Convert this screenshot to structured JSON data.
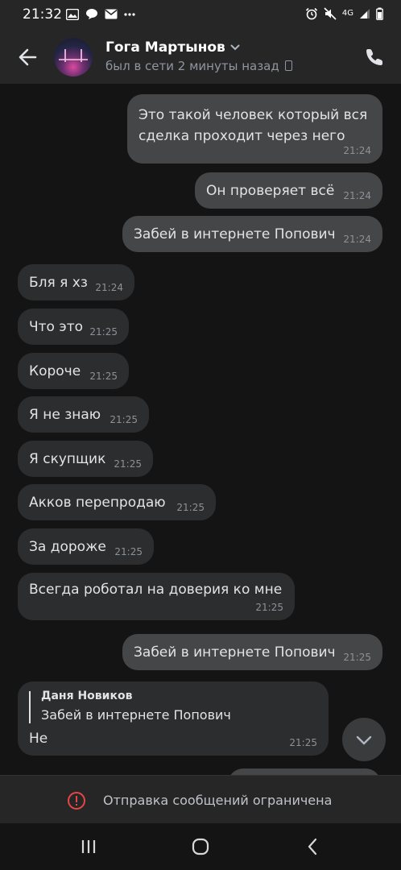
{
  "status_bar": {
    "time": "21:32",
    "network": "4G",
    "icons": [
      "gallery-icon",
      "chat-icon",
      "mail-icon",
      "more-dots-icon",
      "alarm-icon",
      "mute-icon",
      "signal-icon",
      "battery-icon"
    ]
  },
  "header": {
    "name": "Гога Мартынов",
    "status": "был в сети 2 минуты назад",
    "icons": [
      "back-arrow-icon",
      "chevron-down-icon",
      "phone-icon"
    ]
  },
  "messages": [
    {
      "dir": "out",
      "lines": [
        "Это такой человек который вся",
        "сделка проходит через него"
      ],
      "time": "21:24"
    },
    {
      "dir": "out",
      "lines": [
        "Он проверяет всё"
      ],
      "time": "21:24"
    },
    {
      "dir": "out",
      "lines": [
        "Забей в интернете Попович"
      ],
      "time": "21:24"
    },
    {
      "dir": "in",
      "lines": [
        "Бля я хз"
      ],
      "time": "21:24"
    },
    {
      "dir": "in",
      "lines": [
        "Что это"
      ],
      "time": "21:25"
    },
    {
      "dir": "in",
      "lines": [
        "Короче"
      ],
      "time": "21:25"
    },
    {
      "dir": "in",
      "lines": [
        "Я не знаю"
      ],
      "time": "21:25"
    },
    {
      "dir": "in",
      "lines": [
        "Я скупщик"
      ],
      "time": "21:25"
    },
    {
      "dir": "in",
      "lines": [
        "Акков перепродаю"
      ],
      "time": "21:25"
    },
    {
      "dir": "in",
      "lines": [
        "За дороже"
      ],
      "time": "21:25"
    },
    {
      "dir": "in",
      "lines": [
        "Всегда роботал на доверия ко мне"
      ],
      "time": "21:25"
    },
    {
      "dir": "out",
      "lines": [
        "Забей в интернете Попович"
      ],
      "time": "21:25"
    },
    {
      "dir": "in",
      "reply_author": "Даня Новиков",
      "reply_text": "Забей в интернете Попович",
      "lines": [
        "Не"
      ],
      "time": "21:25"
    }
  ],
  "restriction": {
    "text": "Отправка сообщений ограничена",
    "icon": "warning-circle-icon",
    "color": "#e64646"
  },
  "navbar": {
    "icons": [
      "recent-apps-icon",
      "home-icon",
      "nav-back-icon"
    ]
  },
  "colors": {
    "background": "#141414",
    "outgoing_bubble": "#454647",
    "incoming_bubble": "#2c2d2e",
    "header": "#262626"
  }
}
